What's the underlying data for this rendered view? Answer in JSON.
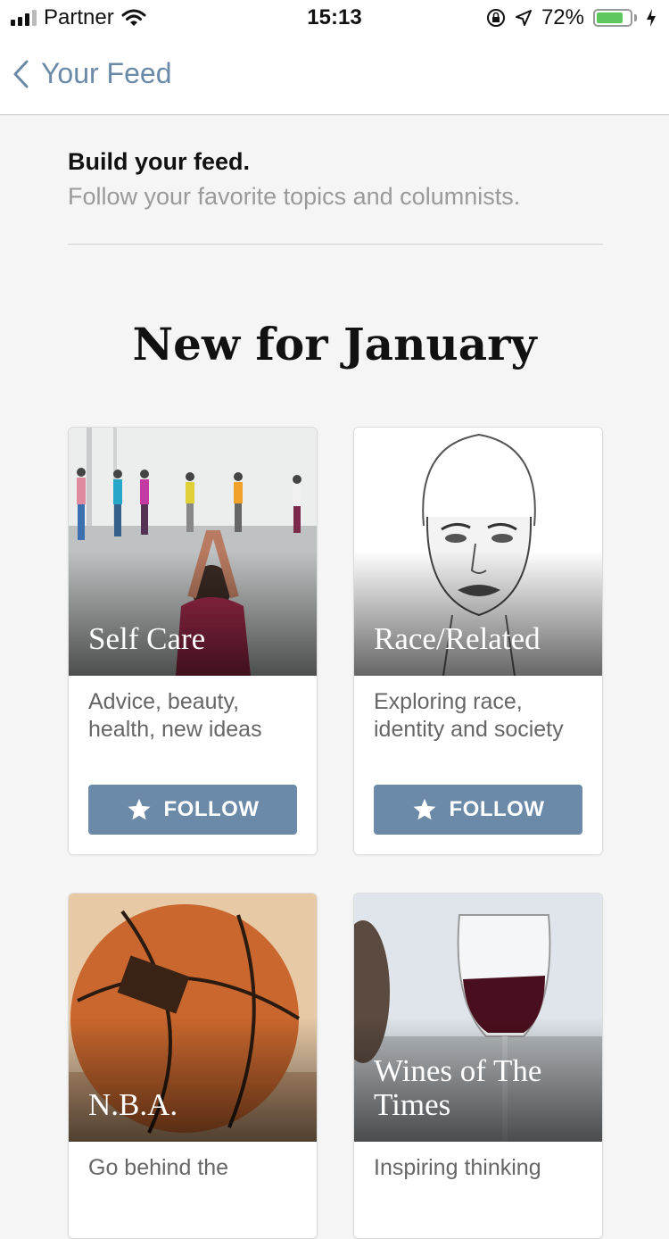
{
  "status_bar": {
    "carrier": "Partner",
    "time": "15:13",
    "battery": "72%",
    "battery_level": 0.72,
    "icons": [
      "signal-icon",
      "wifi-icon",
      "rotation-lock-icon",
      "location-icon",
      "battery-icon",
      "charging-icon"
    ]
  },
  "nav": {
    "back_label": "Your Feed",
    "back_icon": "chevron-left-icon"
  },
  "intro": {
    "title": "Build your feed.",
    "subtitle": "Follow your favorite topics and columnists."
  },
  "section": {
    "title": "New for January"
  },
  "cards": [
    {
      "title": "Self Care",
      "description": "Advice, beauty, health, new ideas",
      "button": "FOLLOW",
      "image": "yoga-class-photo"
    },
    {
      "title": "Race/Related",
      "description": "Exploring race, identity and society",
      "button": "FOLLOW",
      "image": "face-sketch-illustration"
    },
    {
      "title": "N.B.A.",
      "description": "Go behind the",
      "image": "basketball-photo"
    },
    {
      "title": "Wines of The Times",
      "description": "Inspiring thinking",
      "image": "wine-glass-photo"
    }
  ],
  "colors": {
    "accent": "#6a8aa8",
    "background": "#f5f5f5"
  }
}
